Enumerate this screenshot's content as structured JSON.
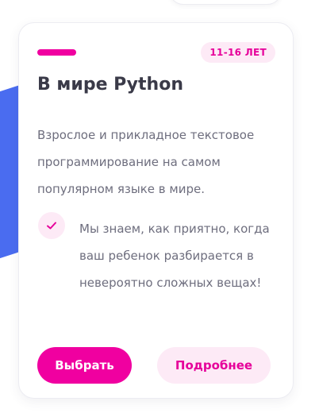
{
  "card": {
    "age_badge": "11-16 ЛЕТ",
    "title": "В мире Python",
    "description": "Взрослое и прикладное текстовое программирование на самом популярном языке в мире.",
    "feature": "Мы знаем, как приятно, когда ваш ребенок разбирается в невероятно сложных вещах!",
    "feature_icon": "check-icon",
    "buttons": {
      "select_label": "Выбрать",
      "details_label": "Подробнее"
    }
  },
  "colors": {
    "accent": "#f000a0",
    "accent_light": "#fdeaf6",
    "decor_blue": "#4a6cf0",
    "text_dark": "#3a3a48",
    "text_muted": "#6e6e7e"
  }
}
